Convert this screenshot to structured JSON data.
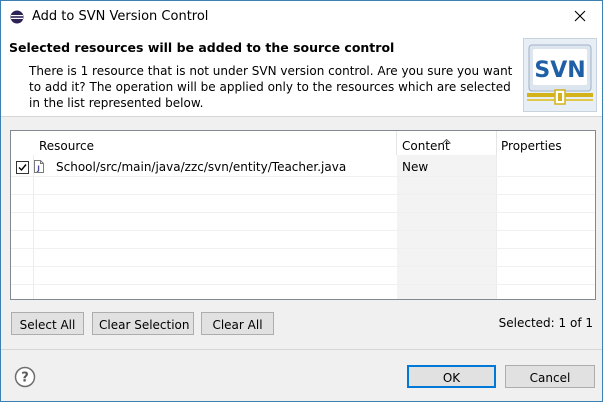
{
  "window": {
    "title": "Add to SVN Version Control"
  },
  "banner": {
    "title": "Selected resources will be added to the source control",
    "message": "There is 1 resource that is not under SVN version control. Are you sure you want to add it? The operation will be applied only to the resources which are selected in the list represented below.",
    "logo_text": "SVN"
  },
  "table": {
    "columns": [
      "Resource",
      "Content",
      "Properties"
    ],
    "rows": [
      {
        "checked": true,
        "resource": "School/src/main/java/zzc/svn/entity/Teacher.java",
        "content": "New",
        "properties": ""
      }
    ]
  },
  "buttons": {
    "select_all": "Select All",
    "clear_selection": "Clear Selection",
    "clear_all": "Clear All",
    "ok": "OK",
    "cancel": "Cancel"
  },
  "status": {
    "selected": "Selected: 1 of 1"
  },
  "icons": {
    "app": "eclipse-icon",
    "close": "close-icon",
    "help": "help-icon",
    "file": "java-file-icon"
  },
  "colors": {
    "border_accent": "#3c7fb1",
    "ok_border": "#0078d7",
    "logo_blue": "#1f5fa5",
    "logo_gold": "#d4b21a"
  }
}
